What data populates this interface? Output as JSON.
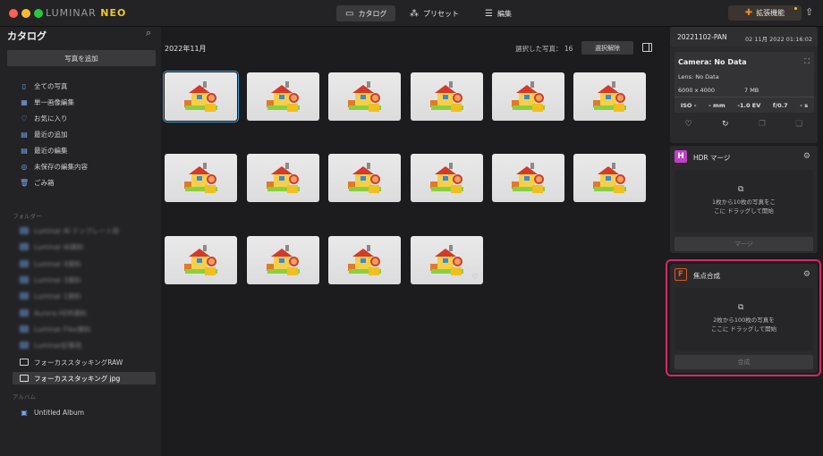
{
  "app": {
    "brand_main": "LUMINAR",
    "brand_accent": "NEO"
  },
  "topnav": {
    "catalog": "カタログ",
    "presets": "プリセット",
    "edit": "編集",
    "extensions": "拡張機能"
  },
  "sidebar": {
    "title": "カタログ",
    "add_photos": "写真を追加",
    "items": [
      {
        "label": "全ての写真",
        "icon": "phone-icon"
      },
      {
        "label": "単一画像編集",
        "icon": "grid-icon"
      },
      {
        "label": "お気に入り",
        "icon": "heart-icon"
      },
      {
        "label": "最近の追加",
        "icon": "calendar-icon"
      },
      {
        "label": "最近の編集",
        "icon": "calendar-edit-icon"
      },
      {
        "label": "未保存の編集内容",
        "icon": "unsaved-icon"
      },
      {
        "label": "ごみ箱",
        "icon": "trash-icon"
      }
    ],
    "folders_label": "フォルダー",
    "folders": [
      "Luminar AI テンプレート用",
      "Luminar AI資料",
      "Luminar 4資料",
      "Luminar 3資料",
      "Luminar 1資料",
      "Aurora HDR資料",
      "Luminar Flex資料",
      "Luminar記事用",
      "フォーカススタッキングRAW",
      "フォーカススタッキング jpg"
    ],
    "albums_label": "アルバム",
    "albums": [
      "Untitled Album"
    ]
  },
  "main": {
    "month": "2022年11月",
    "selected_label": "選択した写真：",
    "selected_count": "16",
    "deselect": "選択解除"
  },
  "info": {
    "filename": "20221102-PAN",
    "date": "02 11月 2022 01:16:02",
    "camera": "Camera: No Data",
    "lens": "Lens: No Data",
    "dimensions": "6000 x 4000",
    "filesize": "7 MB",
    "iso": "ISO -",
    "focal": "- mm",
    "ev": "-1.0 EV",
    "aperture": "f/0.7",
    "shutter": "- s"
  },
  "hdr": {
    "title": "HDR マージ",
    "drop_line1": "1枚から10枚の写真をこ",
    "drop_line2": "こに ドラッグして開始",
    "button": "マージ",
    "logo_color": "#c23fc8"
  },
  "focus": {
    "title": "焦点合成",
    "drop_line1": "2枚から100枚の写真を",
    "drop_line2": "ここに ドラッグして開始",
    "button": "合成",
    "logo_color": "#e0562a",
    "highlight_color": "#d6286a"
  }
}
